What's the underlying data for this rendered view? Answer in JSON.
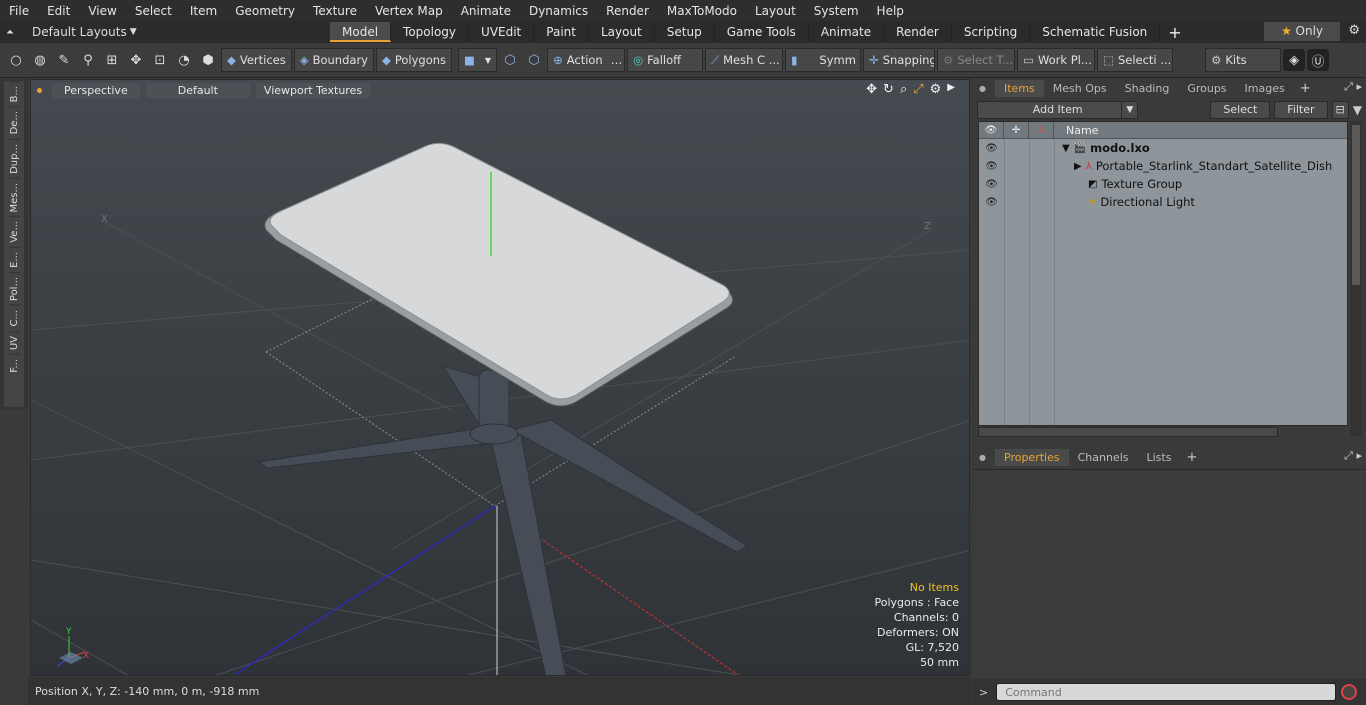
{
  "menu": [
    "File",
    "Edit",
    "View",
    "Select",
    "Item",
    "Geometry",
    "Texture",
    "Vertex Map",
    "Animate",
    "Dynamics",
    "Render",
    "MaxToModo",
    "Layout",
    "System",
    "Help"
  ],
  "layouts_label": "Default Layouts",
  "tabs": [
    "Model",
    "Topology",
    "UVEdit",
    "Paint",
    "Layout",
    "Setup",
    "Game Tools",
    "Animate",
    "Render",
    "Scripting",
    "Schematic Fusion"
  ],
  "active_tab": "Model",
  "only_label": "Only",
  "toolbar": {
    "vertices": "Vertices",
    "boundary": "Boundary",
    "polygons": "Polygons",
    "action": "Action",
    "falloff": "Falloff",
    "mesh": "Mesh C ...",
    "symm": "Symm ...",
    "snapping": "Snapping",
    "select_t": "Select T...",
    "work_pl": "Work Pl...",
    "selecti": "Selecti ...",
    "kits": "Kits"
  },
  "left_tabs": [
    "B...",
    "De...",
    "Dup...",
    "Mes...",
    "Ve...",
    "E...",
    "Pol...",
    "C...",
    "UV",
    "F..."
  ],
  "viewport": {
    "view_mode": "Perspective",
    "shading": "Default",
    "textures": "Viewport Textures",
    "info": {
      "no_items": "No Items",
      "polygons": "Polygons : Face",
      "channels": "Channels: 0",
      "deformers": "Deformers: ON",
      "gl": "GL: 7,520",
      "scale": "50 mm"
    },
    "axis_x": "X",
    "axis_y": "Y",
    "grid_x": "X",
    "grid_z": "Z"
  },
  "status": "Position X, Y, Z:  -140 mm, 0 m, -918 mm",
  "items_panel": {
    "tabs": [
      "Items",
      "Mesh Ops",
      "Shading",
      "Groups",
      "Images"
    ],
    "active_tab": "Items",
    "add_item": "Add Item",
    "select": "Select",
    "filter": "Filter",
    "name_col": "Name",
    "rows": [
      {
        "name": "modo.lxo",
        "bold": true
      },
      {
        "name": "Portable_Starlink_Standart_Satellite_Dish",
        "bold": false
      },
      {
        "name": "Texture Group",
        "bold": false
      },
      {
        "name": "Directional Light",
        "bold": false
      }
    ]
  },
  "props_panel": {
    "tabs": [
      "Properties",
      "Channels",
      "Lists"
    ],
    "active_tab": "Properties"
  },
  "command_placeholder": "Command"
}
